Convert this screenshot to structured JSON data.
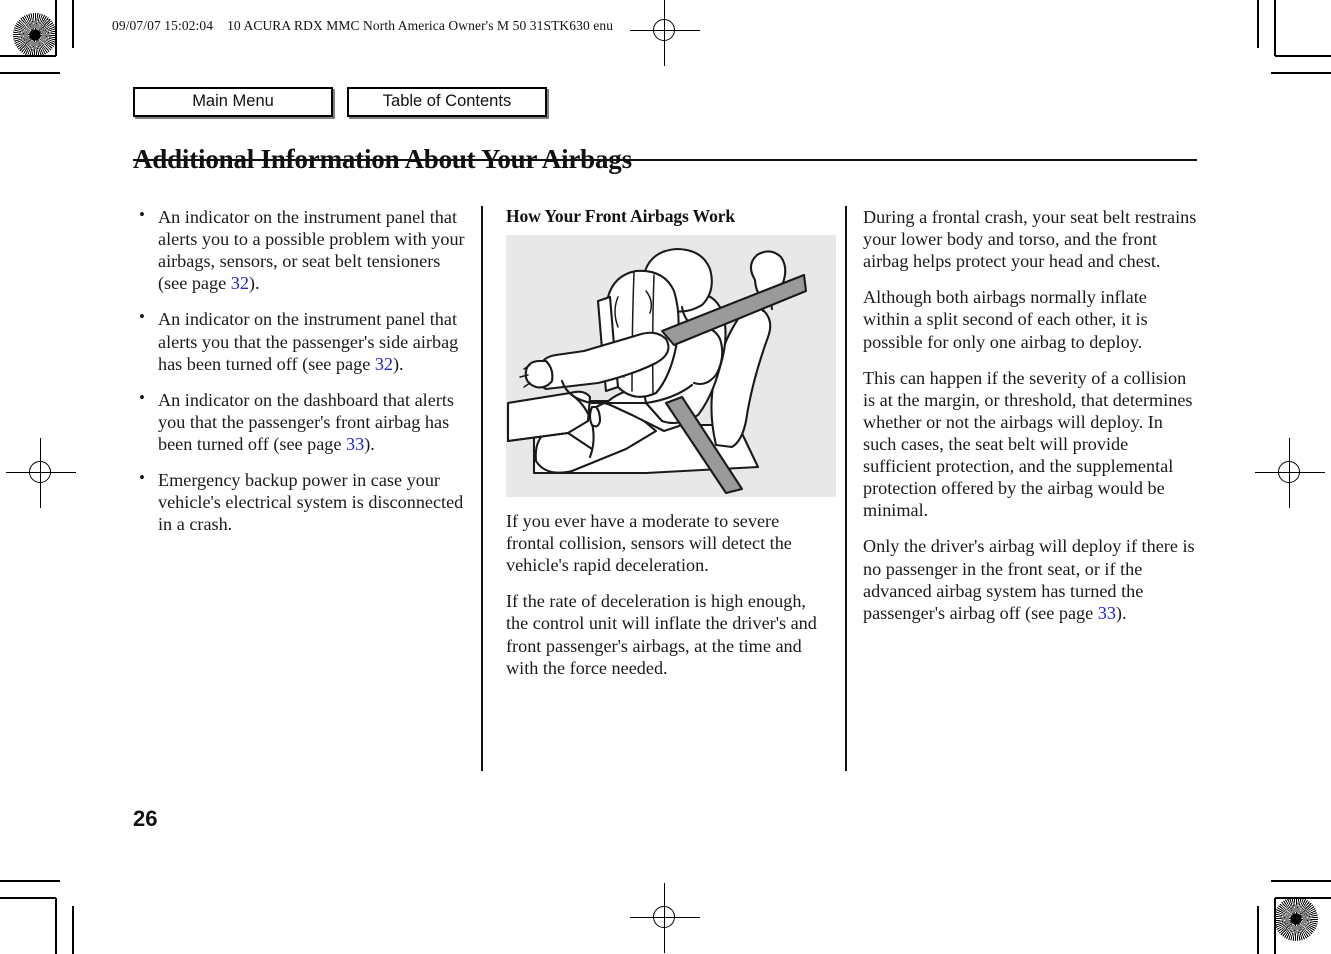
{
  "header": {
    "timestamp": "09/07/07 15:02:04",
    "job_info": "10 ACURA RDX MMC North America Owner's M 50 31STK630 enu"
  },
  "nav": {
    "main_menu_label": "Main Menu",
    "table_of_contents_label": "Table of Contents"
  },
  "page": {
    "title": "Additional Information About Your Airbags",
    "folio": "26"
  },
  "column_left": {
    "bullets": [
      {
        "text_before": "An indicator on the instrument panel that alerts you to a possible problem with your airbags, sensors, or seat belt tensioners (see page ",
        "page_ref": "32",
        "text_after": ")."
      },
      {
        "text_before": "An indicator on the instrument panel that alerts you that the passenger's side airbag has been turned off (see page ",
        "page_ref": "32",
        "text_after": ")."
      },
      {
        "text_before": "An indicator on the dashboard that alerts you that the passenger's front airbag has been turned off (see page ",
        "page_ref": "33",
        "text_after": ")."
      },
      {
        "text_before": "Emergency backup power in case your vehicle's electrical system is disconnected in a crash.",
        "page_ref": "",
        "text_after": ""
      }
    ]
  },
  "column_middle": {
    "heading": "How Your Front Airbags Work",
    "figure_caption": "",
    "figure_alt": "driver-with-deployed-front-airbag-illustration",
    "paragraphs": [
      "If you ever have a moderate to severe frontal collision, sensors will detect the vehicle's rapid deceleration.",
      "If the rate of deceleration is high enough, the control unit will inflate the driver's and front passenger's airbags, at the time and with the force needed."
    ]
  },
  "column_right": {
    "paragraphs": [
      "During a frontal crash, your seat belt restrains your lower body and torso, and the front airbag helps protect your head and chest.",
      "Although both airbags normally inflate within a split second of each other, it is possible for only one airbag to deploy.",
      "This can happen if the severity of a collision is at the margin, or threshold, that determines whether or not the airbags will deploy. In such cases, the seat belt will provide sufficient protection, and the supplemental protection offered by the airbag would be minimal."
    ],
    "last_paragraph": {
      "text_before": "Only the driver's airbag will deploy if there is no passenger in the front seat, or if the advanced airbag system has turned the passenger's airbag off (see page ",
      "page_ref": "33",
      "text_after": ")."
    }
  },
  "colors": {
    "link_blue": "#2222dd",
    "figure_background": "#e8e8e8",
    "text": "#1a1a1a",
    "rule": "#111111"
  }
}
